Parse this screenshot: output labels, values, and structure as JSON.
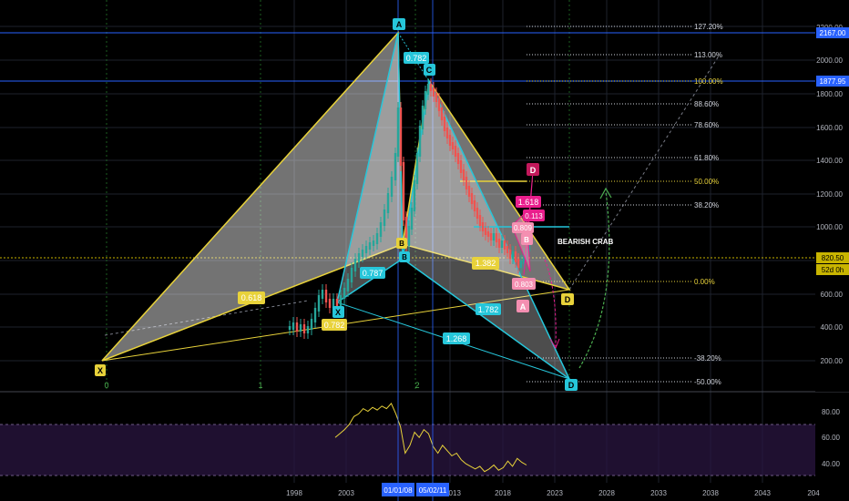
{
  "chart_data": {
    "type": "candlestick",
    "x_axis": {
      "ticks": [
        "1998",
        "2003",
        "2013",
        "2018",
        "2023",
        "2028",
        "2033",
        "2038",
        "2043",
        "204"
      ],
      "highlight_labels": [
        "01/01/08",
        "05/02/11"
      ]
    },
    "y_axis": {
      "ticks": [
        "200.00",
        "400.00",
        "600.00",
        "800.00",
        "1000.00",
        "1200.00",
        "1400.00",
        "1600.00",
        "1800.00",
        "2000.00",
        "2200.00"
      ],
      "price_tags": [
        {
          "label": "2167.00",
          "color": "#2962ff"
        },
        {
          "label": "1877.95",
          "color": "#2962ff"
        },
        {
          "label": "820.50",
          "color": "#c8b400"
        },
        {
          "label": "52d 0h",
          "color": "#c8b400"
        }
      ]
    },
    "fib_levels": [
      {
        "label": "127.20%",
        "color": "#d1d4dc"
      },
      {
        "label": "113.00%",
        "color": "#d1d4dc"
      },
      {
        "label": "100.00%",
        "color": "#e8d23a"
      },
      {
        "label": "88.60%",
        "color": "#d1d4dc"
      },
      {
        "label": "78.60%",
        "color": "#d1d4dc"
      },
      {
        "label": "61.80%",
        "color": "#d1d4dc"
      },
      {
        "label": "50.00%",
        "color": "#e8d23a"
      },
      {
        "label": "38.20%",
        "color": "#d1d4dc"
      },
      {
        "label": "0.00%",
        "color": "#e8d23a"
      },
      {
        "label": "-38.20%",
        "color": "#d1d4dc"
      },
      {
        "label": "-50.00%",
        "color": "#d1d4dc"
      }
    ],
    "cycle_labels": [
      "0",
      "1",
      "2"
    ],
    "pattern_points": {
      "yellow": [
        "X",
        "B",
        "D"
      ],
      "cyan": [
        "A",
        "C",
        "X",
        "B",
        "D"
      ],
      "magenta": [
        "D",
        "B",
        "A"
      ]
    },
    "ratio_labels": {
      "yellow": [
        "0.618",
        "1.382"
      ],
      "cyan": [
        "0.782",
        "0.787",
        "0.782",
        "1.782",
        "1.268"
      ],
      "magenta": [
        "1.618",
        "0.113",
        "0.809",
        "0.803"
      ]
    },
    "annotation": "BEARISH CRAB",
    "oscillator": {
      "ticks": [
        "80.00",
        "60.00",
        "40.00"
      ],
      "values": [
        62,
        65,
        68,
        72,
        78,
        80,
        84,
        82,
        85,
        83,
        86,
        84,
        88,
        80,
        70,
        50,
        56,
        66,
        62,
        68,
        65,
        55,
        50,
        56,
        52,
        48,
        50,
        45,
        42,
        40,
        38,
        40,
        36,
        38,
        41,
        37,
        39,
        44,
        40,
        46,
        43,
        41
      ]
    },
    "colors": {
      "background": "#000000",
      "yellow_pattern": "#e8d23a",
      "cyan_pattern": "#26c6da",
      "magenta_pattern": "#e91e8c",
      "up_candle": "#26a69a",
      "down_candle": "#ef5350",
      "horizontal_blue": "#2962ff",
      "oscillator_band": "#2a1540"
    }
  }
}
